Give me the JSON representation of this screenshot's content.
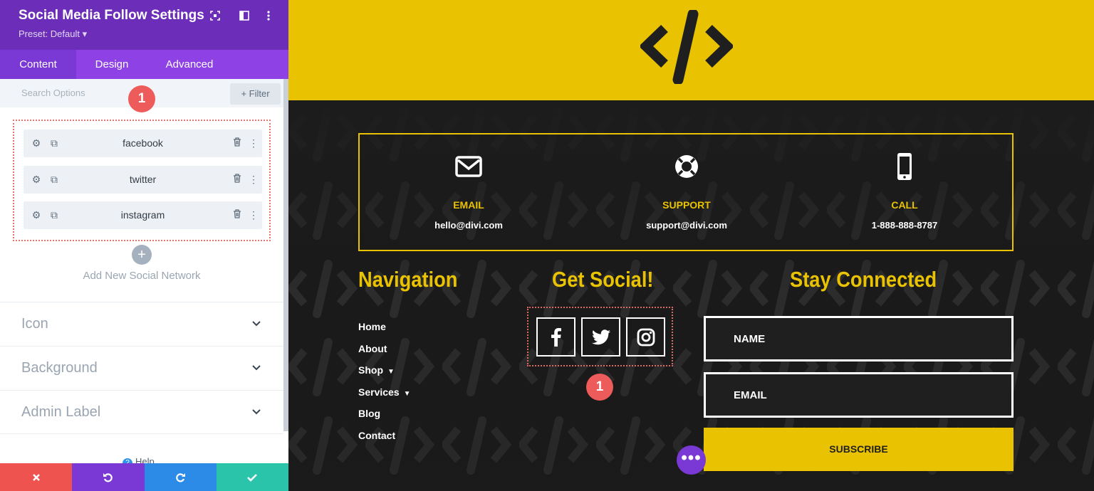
{
  "panel": {
    "title": "Social Media Follow Settings",
    "preset": "Preset: Default ▾",
    "tabs": [
      {
        "label": "Content",
        "active": true
      },
      {
        "label": "Design",
        "active": false
      },
      {
        "label": "Advanced",
        "active": false
      }
    ],
    "search_placeholder": "Search Options",
    "filter_label": "+ Filter",
    "networks": [
      "facebook",
      "twitter",
      "instagram"
    ],
    "add_label": "Add New Social Network",
    "sections": [
      "Icon",
      "Background",
      "Admin Label"
    ],
    "help_label": "Help",
    "badge": "1"
  },
  "preview": {
    "contact": [
      {
        "icon": "envelope-icon",
        "title": "EMAIL",
        "value": "hello@divi.com"
      },
      {
        "icon": "lifebuoy-icon",
        "title": "SUPPORT",
        "value": "support@divi.com"
      },
      {
        "icon": "phone-icon",
        "title": "CALL",
        "value": "1-888-888-8787"
      }
    ],
    "navigation": {
      "heading": "Navigation",
      "items": [
        "Home",
        "About",
        "Shop",
        "Services",
        "Blog",
        "Contact"
      ]
    },
    "social": {
      "heading": "Get Social!",
      "icons": [
        "facebook-icon",
        "twitter-icon",
        "instagram-icon"
      ],
      "badge": "1"
    },
    "connect": {
      "heading": "Stay Connected",
      "name_placeholder": "NAME",
      "email_placeholder": "EMAIL",
      "subscribe_label": "SUBSCRIBE"
    },
    "fab": "•••"
  },
  "colors": {
    "brand_purple": "#6c2eb9",
    "tab_purple": "#8e42e6",
    "accent_yellow": "#e9c302",
    "badge_red": "#ee5b5b",
    "cancel": "#ef5350",
    "undo": "#7a38d4",
    "redo": "#2d8be8",
    "save": "#29c4a9"
  }
}
